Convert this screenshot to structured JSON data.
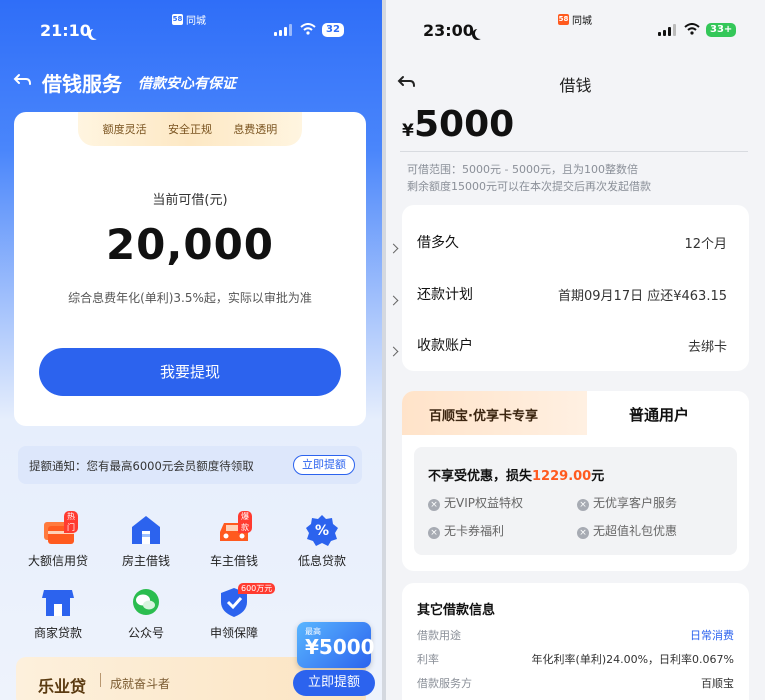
{
  "left": {
    "status": {
      "time": "21:10",
      "battery": "32",
      "app_tag": "同城"
    },
    "header": {
      "title": "借钱服务",
      "slogan": "借款安心有保证"
    },
    "features": [
      "额度灵活",
      "安全正规",
      "息费透明"
    ],
    "limit": {
      "label": "当前可借(元)",
      "amount": "20,000",
      "rate_note": "综合息费年化(单利)3.5%起，实际以审批为准"
    },
    "withdraw_button": "我要提现",
    "notice": {
      "text": "提额通知：您有最高6000元会员额度待领取",
      "action": "立即提额"
    },
    "quick_links": [
      {
        "label": "大额信用贷",
        "badge": "热门",
        "icon": "credit-card-icon"
      },
      {
        "label": "房主借钱",
        "badge": "",
        "icon": "house-icon"
      },
      {
        "label": "车主借钱",
        "badge": "爆款",
        "icon": "car-icon"
      },
      {
        "label": "低息贷款",
        "badge": "",
        "icon": "percent-icon"
      },
      {
        "label": "商家贷款",
        "badge": "",
        "icon": "shop-icon"
      },
      {
        "label": "公众号",
        "badge": "",
        "icon": "wechat-icon"
      },
      {
        "label": "申领保障",
        "badge": "600万元",
        "icon": "shield-icon"
      }
    ],
    "banner": {
      "brand": "乐业贷",
      "tagline": "成就奋斗者"
    },
    "float_promo": {
      "small": "最高",
      "amount": "¥5000",
      "button": "立即提额"
    }
  },
  "right": {
    "status": {
      "time": "23:00",
      "battery": "33+",
      "app_tag": "同城"
    },
    "title": "借钱",
    "amount": {
      "currency": "¥",
      "value": "5000"
    },
    "range_note": "可借范围：5000元 - 5000元，且为100整数倍",
    "remain_note": "剩余额度15000元可以在本次提交后再次发起借款",
    "rows": [
      {
        "label": "借多久",
        "value": "12个月"
      },
      {
        "label": "还款计划",
        "value": "首期09月17日 应还¥463.15"
      },
      {
        "label": "收款账户",
        "value": "去绑卡"
      }
    ],
    "tabs": {
      "vip": "百顺宝·优享卡专享",
      "normal": "普通用户"
    },
    "loss": {
      "prefix": "不享受优惠，损失",
      "amount": "1229.00",
      "suffix": "元"
    },
    "benefits": [
      "无VIP权益特权",
      "无优享客户服务",
      "无卡券福利",
      "无超值礼包优惠"
    ],
    "other_info": {
      "title": "其它借款信息",
      "rows": [
        {
          "label": "借款用途",
          "value": "日常消费"
        },
        {
          "label": "利率",
          "value": "年化利率(单利)24.00%，日利率0.067%"
        },
        {
          "label": "借款服务方",
          "value": "百顺宝"
        }
      ]
    }
  },
  "colors": {
    "primary": "#2c63ee",
    "orange": "#ff5a1f",
    "dark": "#1a1a1a"
  }
}
